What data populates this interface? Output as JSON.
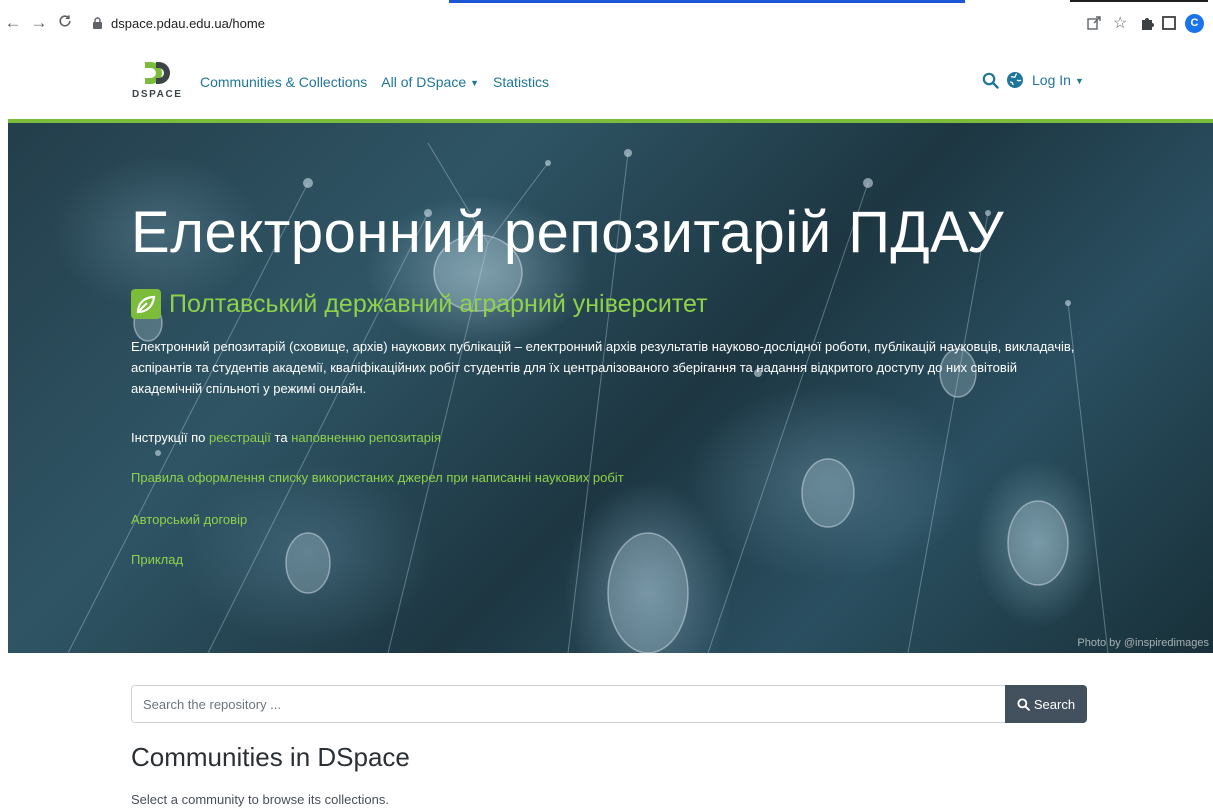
{
  "browser": {
    "url": "dspace.pdau.edu.ua/home",
    "avatar_letter": "C"
  },
  "navbar": {
    "logo_text": "DSPACE",
    "links": [
      {
        "label": "Communities & Collections"
      },
      {
        "label": "All of DSpace"
      },
      {
        "label": "Statistics"
      }
    ],
    "login_label": "Log In"
  },
  "hero": {
    "title": "Електронний репозитарій ПДАУ",
    "subtitle": "Полтавський державний аграрний університет",
    "description": "Електронний репозитарій (сховище, архів) наукових публікацій – електронний архів результатів науково-дослідної роботи, публікацій науковців, викладачів, аспірантів та студентів академії, кваліфікаційних робіт студентів для їх централізованого зберігання та надання відкритого доступу до них світовій академічній спільноті у режимі онлайн.",
    "instructions_prefix": "Інструкції по",
    "instructions_link1": "реєстрації",
    "instructions_and": "та",
    "instructions_link2": "наповненню репозитарія",
    "rules_link": "Правила оформлення списку використаних джерел при написанні наукових робіт",
    "author_agreement_link": "Авторський договір",
    "example_link": "Приклад",
    "photo_credit": "Photo by @inspiredimages"
  },
  "search": {
    "placeholder": "Search the repository ...",
    "button_label": "Search"
  },
  "communities": {
    "title": "Communities in DSpace",
    "subtitle": "Select a community to browse its collections."
  },
  "colors": {
    "brand_green": "#7bbd3a",
    "link_blue": "#207698",
    "search_button": "#43515f"
  }
}
